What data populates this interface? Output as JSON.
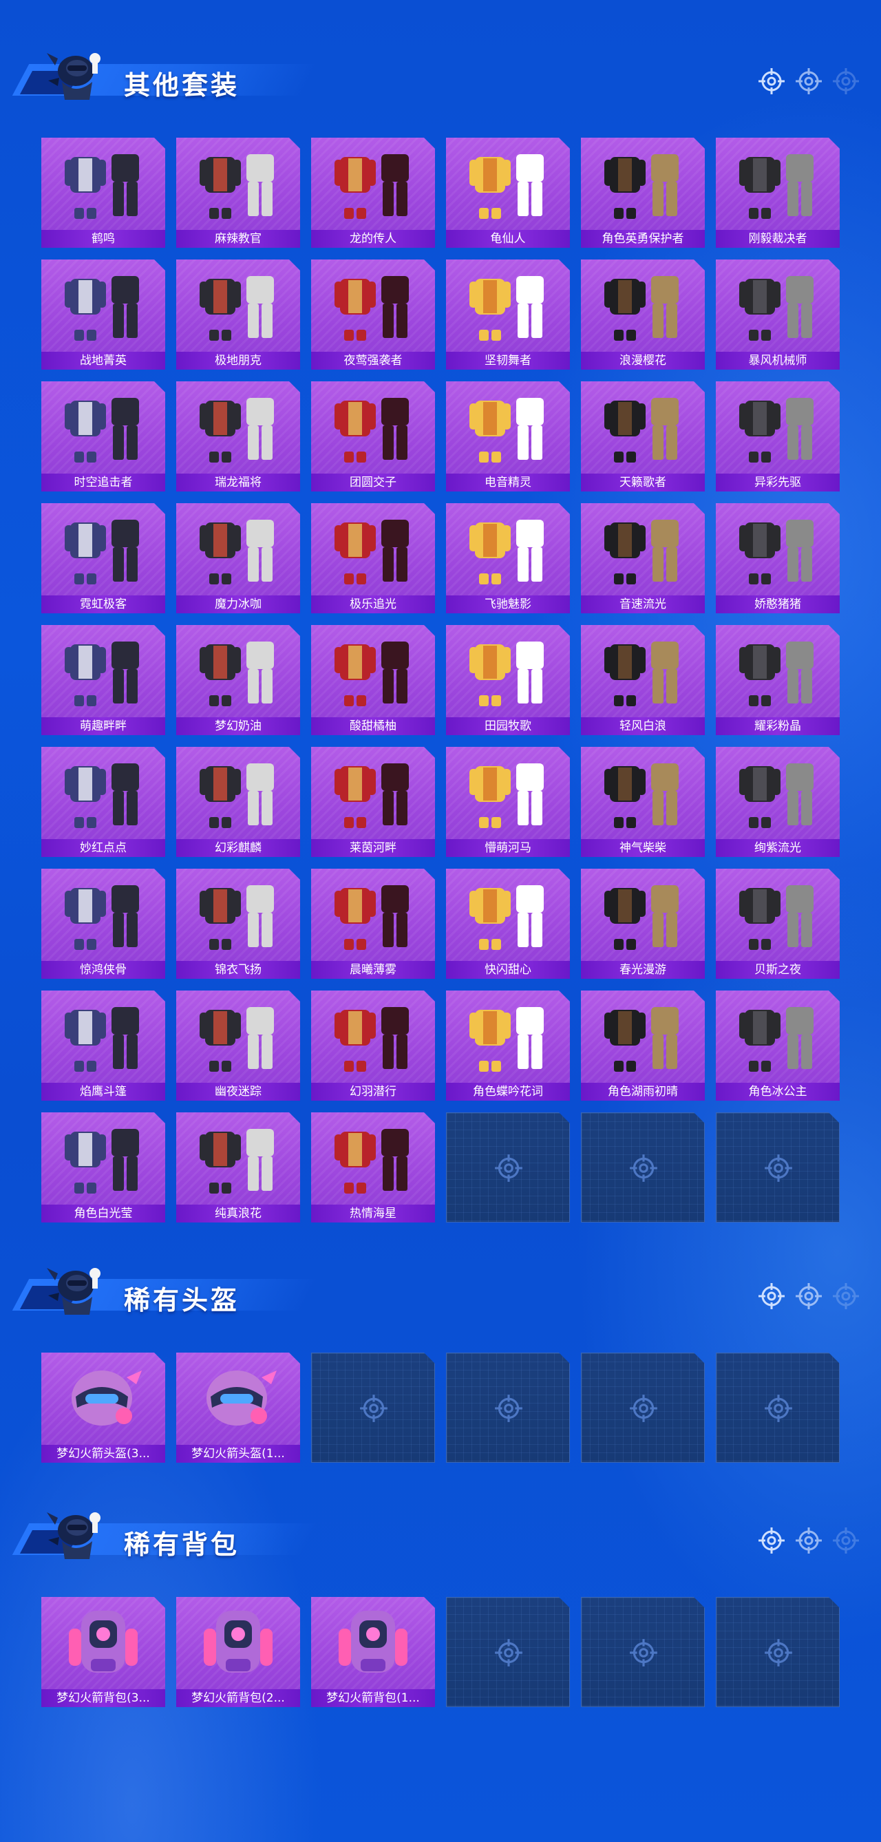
{
  "sections": [
    {
      "title": "其他套装",
      "items": [
        "鹤鸣",
        "麻辣教官",
        "龙的传人",
        "龟仙人",
        "角色英勇保护者",
        "刚毅裁决者",
        "战地菁英",
        "极地朋克",
        "夜莺强袭者",
        "坚韧舞者",
        "浪漫樱花",
        "暴风机械师",
        "时空追击者",
        "瑞龙福将",
        "团圆交子",
        "电音精灵",
        "天籁歌者",
        "异彩先驱",
        "霓虹极客",
        "魔力冰咖",
        "极乐追光",
        "飞驰魅影",
        "音速流光",
        "娇憨猪猪",
        "萌趣畔畔",
        "梦幻奶油",
        "酸甜橘柚",
        "田园牧歌",
        "轻风白浪",
        "耀彩粉晶",
        "妙红点点",
        "幻彩麒麟",
        "莱茵河畔",
        "懵萌河马",
        "神气柴柴",
        "绚紫流光",
        "惊鸿侠骨",
        "锦衣飞扬",
        "晨曦薄雾",
        "快闪甜心",
        "春光漫游",
        "贝斯之夜",
        "焰鹰斗篷",
        "幽夜迷踪",
        "幻羽潜行",
        "角色蝶吟花词",
        "角色湖雨初晴",
        "角色冰公主",
        "角色白光莹",
        "纯真浪花",
        "热情海星"
      ],
      "empty_slots": 3
    },
    {
      "title": "稀有头盔",
      "items": [
        "梦幻火箭头盔(3...",
        "梦幻火箭头盔(1..."
      ],
      "empty_slots": 4
    },
    {
      "title": "稀有背包",
      "items": [
        "梦幻火箭背包(3...",
        "梦幻火箭背包(2...",
        "梦幻火箭背包(1..."
      ],
      "empty_slots": 3
    }
  ],
  "icons": {
    "header_target": "crosshair-icon",
    "empty_slot": "crosshair-icon"
  },
  "colors": {
    "background": "#0b52d8",
    "card": "#a452e2",
    "card_label": "#7a22d6",
    "empty_card": "#1a3d7a"
  }
}
